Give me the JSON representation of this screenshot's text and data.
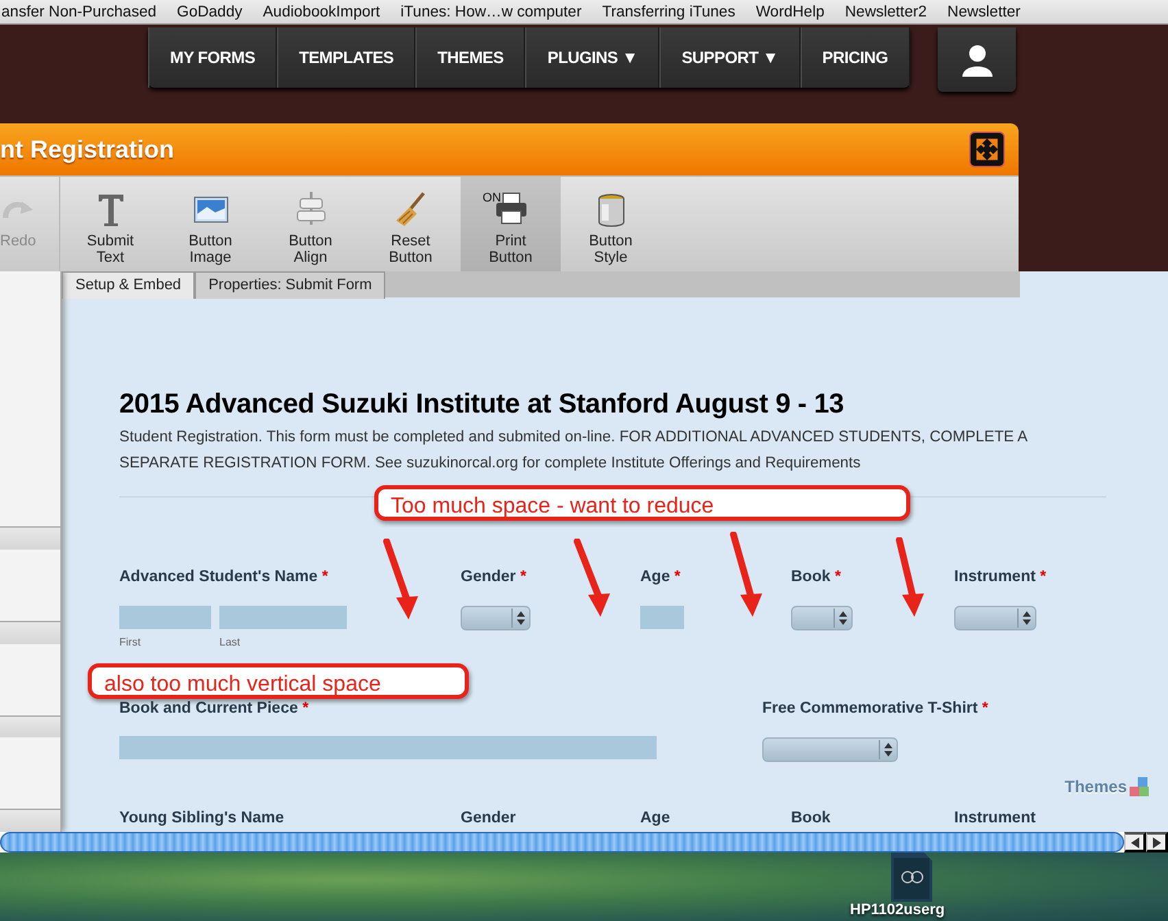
{
  "bookmarks": [
    "ansfer Non-Purchased",
    "GoDaddy",
    "AudiobookImport",
    "iTunes: How…w computer",
    "Transferring iTunes",
    "WordHelp",
    "Newsletter2",
    "Newsletter"
  ],
  "nav": [
    {
      "label": "MY FORMS"
    },
    {
      "label": "TEMPLATES"
    },
    {
      "label": "THEMES"
    },
    {
      "label": "PLUGINS ▼"
    },
    {
      "label": "SUPPORT ▼"
    },
    {
      "label": "PRICING"
    }
  ],
  "window": {
    "title": "nt Registration"
  },
  "toolbar": [
    {
      "label": "Redo",
      "kind": "redo",
      "disabled": true,
      "selected": false
    },
    {
      "label": "Submit Text",
      "kind": "text",
      "disabled": false,
      "selected": false
    },
    {
      "label": "Button Image",
      "kind": "image",
      "disabled": false,
      "selected": false
    },
    {
      "label": "Button Align",
      "kind": "align",
      "disabled": false,
      "selected": false
    },
    {
      "label": "Reset Button",
      "kind": "broom",
      "disabled": false,
      "selected": false
    },
    {
      "label": "Print Button",
      "kind": "printer",
      "badge": "ON",
      "disabled": false,
      "selected": true
    },
    {
      "label": "Button Style",
      "kind": "paint",
      "disabled": false,
      "selected": false
    }
  ],
  "tabs": [
    {
      "label": "Setup & Embed",
      "selected": true
    },
    {
      "label": "Properties: Submit Form",
      "selected": false
    }
  ],
  "form": {
    "title": "2015 Advanced Suzuki Institute at Stanford August 9 - 13",
    "description": "Student Registration. This form must be completed and submited on-line. FOR ADDITIONAL ADVANCED STUDENTS, COMPLETE A SEPARATE REGISTRATION FORM. See suzukinorcal.org for complete Institute Offerings and Requirements",
    "rows": [
      {
        "fields": [
          {
            "label": "Advanced Student's Name",
            "required_mark": "*",
            "kind": "name",
            "sublabels": [
              "First",
              "Last"
            ]
          },
          {
            "label": "Gender",
            "required_mark": "*",
            "kind": "select"
          },
          {
            "label": "Age",
            "required_mark": "*",
            "kind": "short"
          },
          {
            "label": "Book",
            "required_mark": "*",
            "kind": "select"
          },
          {
            "label": "Instrument",
            "required_mark": "*",
            "kind": "select"
          }
        ]
      },
      {
        "fields": [
          {
            "label": "Book and Current Piece",
            "required_mark": "*",
            "kind": "wide"
          },
          {
            "label": "Free Commemorative T-Shirt",
            "required_mark": "*",
            "kind": "select-wide"
          }
        ]
      },
      {
        "fields": [
          {
            "label": "Young Sibling's Name",
            "kind": "none"
          },
          {
            "label": "Gender",
            "kind": "none"
          },
          {
            "label": "Age",
            "kind": "none"
          },
          {
            "label": "Book",
            "kind": "none"
          },
          {
            "label": "Instrument",
            "kind": "none"
          }
        ]
      }
    ],
    "themes_link": "Themes"
  },
  "annotations": [
    {
      "text": "Too much space - want to reduce"
    },
    {
      "text": "also too much vertical space"
    }
  ],
  "desktop_icon": {
    "label": "HP1102userg"
  }
}
